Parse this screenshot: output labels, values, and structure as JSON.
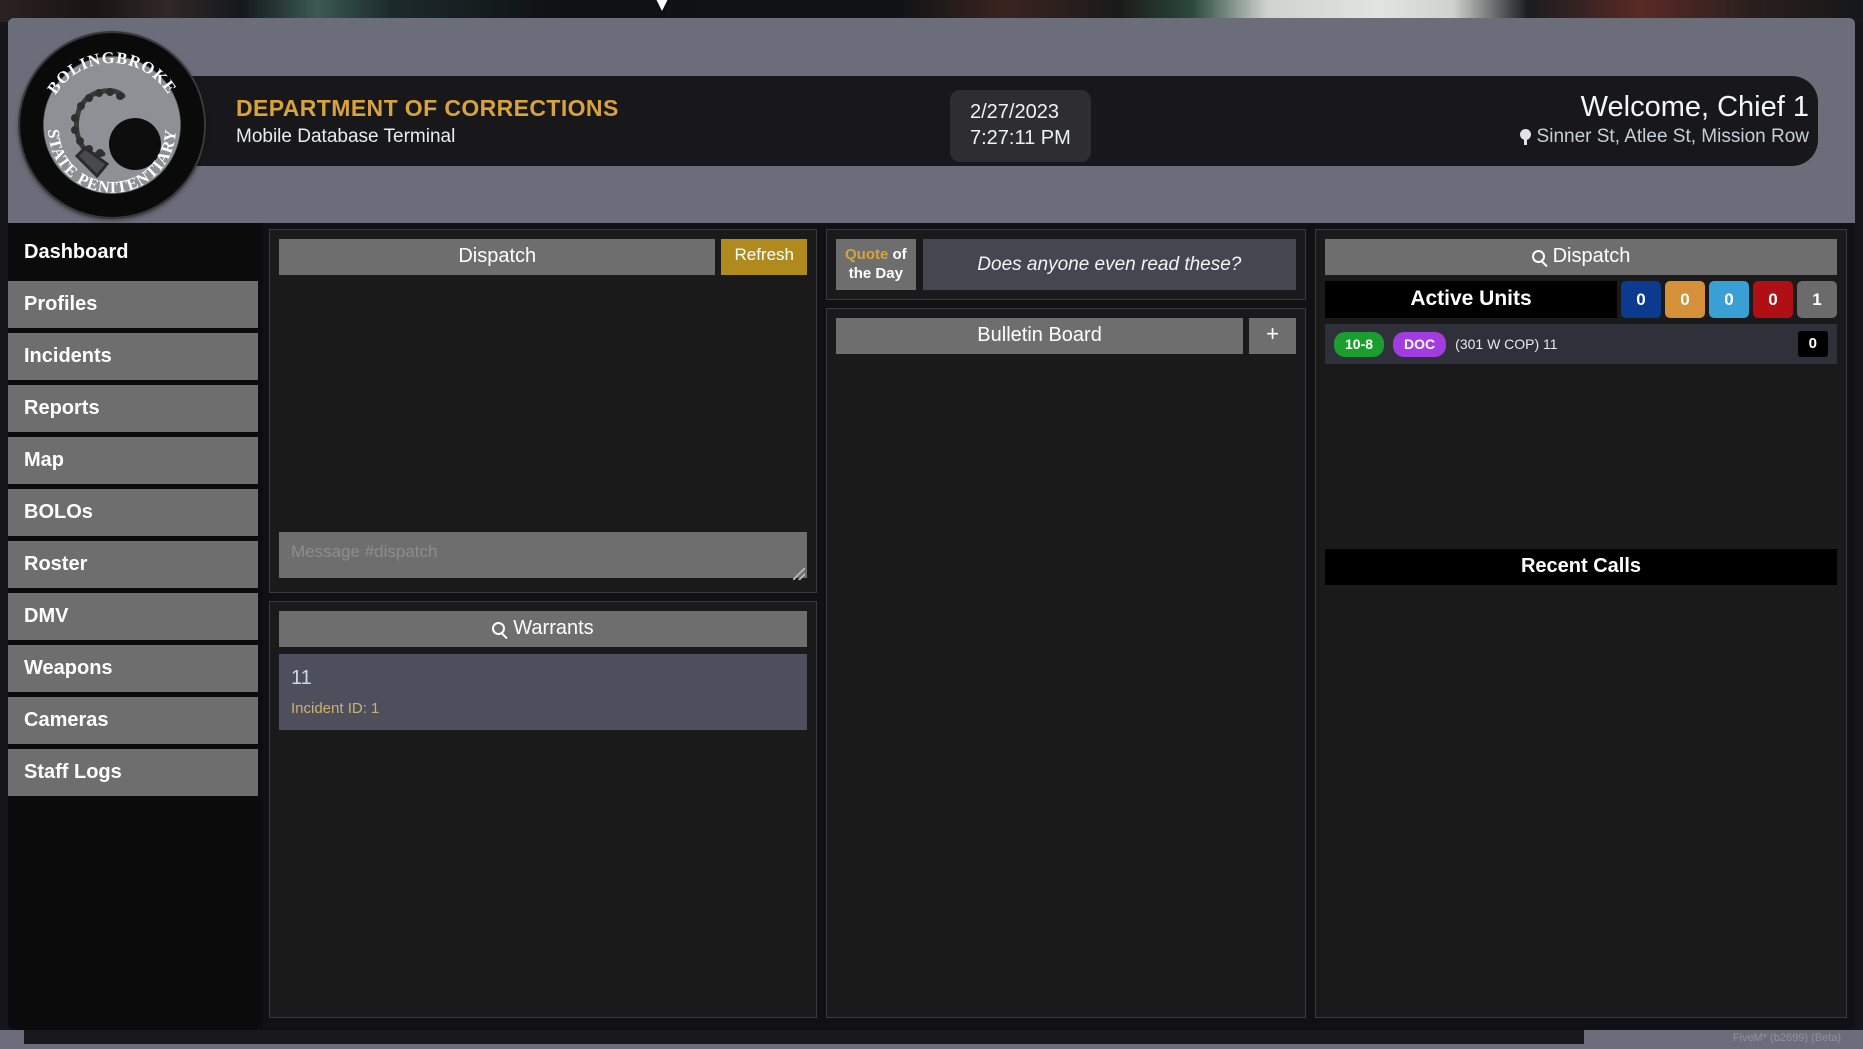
{
  "window": {
    "backdrop_note": "desktop-strip",
    "taskbar_label": "FiveM* (b2699) (Beta)"
  },
  "header": {
    "seal": {
      "top_text": "BOLINGBROKE",
      "bottom_text": "STATE PENITENTIARY",
      "icon": "ball-and-chain-icon"
    },
    "brand_title": "DEPARTMENT OF CORRECTIONS",
    "brand_subtitle": "Mobile Database Terminal",
    "date": "2/27/2023",
    "time": "7:27:11 PM",
    "welcome": "Welcome, Chief 1",
    "location": "Sinner St, Atlee St, Mission Row",
    "colors": {
      "brand_gold": "#d8a33c",
      "window_bg": "#6b6e7a",
      "bar_bg": "#18181a"
    }
  },
  "sidebar": {
    "items": [
      {
        "label": "Dashboard",
        "active": true
      },
      {
        "label": "Profiles",
        "active": false
      },
      {
        "label": "Incidents",
        "active": false
      },
      {
        "label": "Reports",
        "active": false
      },
      {
        "label": "Map",
        "active": false
      },
      {
        "label": "BOLOs",
        "active": false
      },
      {
        "label": "Roster",
        "active": false
      },
      {
        "label": "DMV",
        "active": false
      },
      {
        "label": "Weapons",
        "active": false
      },
      {
        "label": "Cameras",
        "active": false
      },
      {
        "label": "Staff Logs",
        "active": false
      }
    ]
  },
  "dispatch_panel": {
    "title": "Dispatch",
    "refresh_label": "Refresh",
    "messages": [],
    "input_placeholder": "Message #dispatch",
    "input_value": ""
  },
  "warrants_panel": {
    "title": "Warrants",
    "icon": "search-icon",
    "items": [
      {
        "name": "11",
        "meta": "Incident ID: 1"
      }
    ]
  },
  "quote_panel": {
    "tag_line1_gold": "Quote",
    "tag_line1_white": "of",
    "tag_line2": "the Day",
    "quote": "Does anyone even read these?"
  },
  "bulletin_panel": {
    "title": "Bulletin Board",
    "add_label": "+",
    "items": []
  },
  "dispatch_right": {
    "title": "Dispatch",
    "icon": "search-icon",
    "active_units_label": "Active Units",
    "counters": [
      {
        "value": "0",
        "color": "#0b3a8f"
      },
      {
        "value": "0",
        "color": "#d4913a"
      },
      {
        "value": "0",
        "color": "#3a9fd4"
      },
      {
        "value": "0",
        "color": "#b01015"
      },
      {
        "value": "1",
        "color": "#6b6b6b"
      }
    ],
    "units": [
      {
        "status": "10-8",
        "status_color": "#1a9e2e",
        "department": "DOC",
        "department_color": "#a33ce0",
        "callsign": "(301 W COP) 11",
        "count": "0"
      }
    ],
    "recent_calls_label": "Recent Calls",
    "recent_calls": []
  }
}
